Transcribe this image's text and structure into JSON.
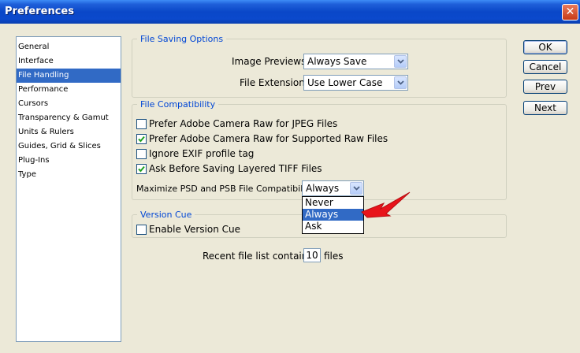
{
  "window": {
    "title": "Preferences",
    "close_glyph": "✕"
  },
  "sidebar": {
    "items": [
      {
        "label": "General"
      },
      {
        "label": "Interface"
      },
      {
        "label": "File Handling",
        "selected": true
      },
      {
        "label": "Performance"
      },
      {
        "label": "Cursors"
      },
      {
        "label": "Transparency & Gamut"
      },
      {
        "label": "Units & Rulers"
      },
      {
        "label": "Guides, Grid & Slices"
      },
      {
        "label": "Plug-Ins"
      },
      {
        "label": "Type"
      }
    ]
  },
  "file_saving": {
    "legend": "File Saving Options",
    "image_previews_label": "Image Previews:",
    "image_previews_value": "Always Save",
    "file_extension_label": "File Extension:",
    "file_extension_value": "Use Lower Case"
  },
  "file_compat": {
    "legend": "File Compatibility",
    "options": [
      {
        "label": "Prefer Adobe Camera Raw for JPEG Files",
        "checked": false
      },
      {
        "label": "Prefer Adobe Camera Raw for Supported Raw Files",
        "checked": true
      },
      {
        "label": "Ignore EXIF profile tag",
        "checked": false
      },
      {
        "label": "Ask Before Saving Layered TIFF Files",
        "checked": true
      }
    ],
    "maximize_label": "Maximize PSD and PSB File Compatibility:",
    "maximize_value": "Always",
    "maximize_options": [
      "Never",
      "Always",
      "Ask"
    ],
    "maximize_highlighted": "Always"
  },
  "version_cue": {
    "legend": "Version Cue",
    "enable_label": "Enable Version Cue",
    "enable_checked": false
  },
  "recent_files": {
    "label": "Recent file list contains:",
    "value": "10",
    "suffix": "files"
  },
  "buttons": {
    "ok": "OK",
    "cancel": "Cancel",
    "prev": "Prev",
    "next": "Next"
  },
  "annotation": {
    "arrow_color": "#E8141B",
    "points_to": "Always"
  },
  "colors": {
    "titlebar": "#0A47C8",
    "selection": "#316AC5",
    "legend_text": "#0046D5",
    "dialog_bg": "#ECE9D8"
  }
}
